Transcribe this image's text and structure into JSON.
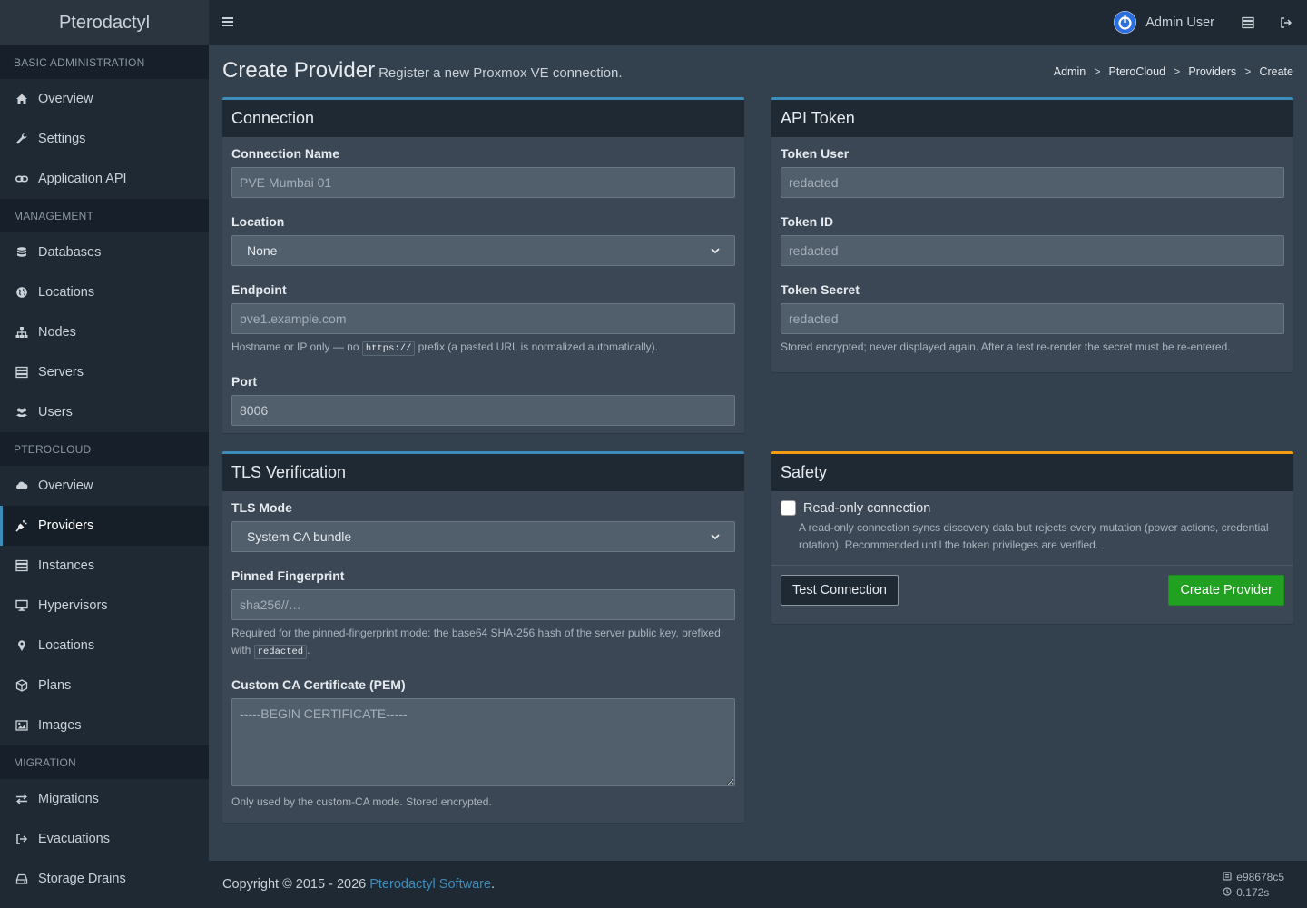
{
  "brand": "Pterodactyl",
  "sidebar": {
    "sections": [
      {
        "title": "BASIC ADMINISTRATION",
        "items": [
          {
            "label": "Overview",
            "icon": "home-icon"
          },
          {
            "label": "Settings",
            "icon": "wrench-icon"
          },
          {
            "label": "Application API",
            "icon": "link-icon"
          }
        ]
      },
      {
        "title": "MANAGEMENT",
        "items": [
          {
            "label": "Databases",
            "icon": "database-icon"
          },
          {
            "label": "Locations",
            "icon": "globe-icon"
          },
          {
            "label": "Nodes",
            "icon": "sitemap-icon"
          },
          {
            "label": "Servers",
            "icon": "server-icon"
          },
          {
            "label": "Users",
            "icon": "users-icon"
          }
        ]
      },
      {
        "title": "PTEROCLOUD",
        "items": [
          {
            "label": "Overview",
            "icon": "cloud-icon"
          },
          {
            "label": "Providers",
            "icon": "plug-icon"
          },
          {
            "label": "Instances",
            "icon": "server-icon"
          },
          {
            "label": "Hypervisors",
            "icon": "desktop-icon"
          },
          {
            "label": "Locations",
            "icon": "map-marker-icon"
          },
          {
            "label": "Plans",
            "icon": "cube-icon"
          },
          {
            "label": "Images",
            "icon": "image-icon"
          }
        ]
      },
      {
        "title": "MIGRATION",
        "items": [
          {
            "label": "Migrations",
            "icon": "exchange-icon"
          },
          {
            "label": "Evacuations",
            "icon": "sign-out-icon"
          },
          {
            "label": "Storage Drains",
            "icon": "hdd-icon"
          }
        ]
      }
    ],
    "active_item": "Providers"
  },
  "topbar": {
    "user_name": "Admin User"
  },
  "page": {
    "title": "Create Provider",
    "subtitle": "Register a new Proxmox VE connection.",
    "breadcrumb": [
      "Admin",
      "PteroCloud",
      "Providers",
      "Create"
    ],
    "breadcrumb_separator": ">"
  },
  "connection": {
    "title": "Connection",
    "name_label": "Connection Name",
    "name_placeholder": "PVE Mumbai 01",
    "location_label": "Location",
    "location_value": "None",
    "endpoint_label": "Endpoint",
    "endpoint_placeholder": "pve1.example.com",
    "endpoint_help_pre": "Hostname or IP only — no",
    "endpoint_help_code": "https://",
    "endpoint_help_post": "prefix (a pasted URL is normalized automatically).",
    "port_label": "Port",
    "port_value": "8006"
  },
  "api_token": {
    "title": "API Token",
    "user_label": "Token User",
    "user_placeholder": "redacted",
    "id_label": "Token ID",
    "id_placeholder": "redacted",
    "secret_label": "Token Secret",
    "secret_placeholder": "redacted",
    "secret_help": "Stored encrypted; never displayed again. After a test re-render the secret must be re-entered."
  },
  "tls": {
    "title": "TLS Verification",
    "mode_label": "TLS Mode",
    "mode_value": "System CA bundle",
    "fingerprint_label": "Pinned Fingerprint",
    "fingerprint_placeholder": "sha256//…",
    "fingerprint_help_pre": "Required for the pinned-fingerprint mode: the base64 SHA-256 hash of the server public key, prefixed with",
    "fingerprint_help_code": "redacted",
    "fingerprint_help_post": ".",
    "ca_label": "Custom CA Certificate (PEM)",
    "ca_placeholder": "-----BEGIN CERTIFICATE-----",
    "ca_help": "Only used by the custom-CA mode. Stored encrypted."
  },
  "safety": {
    "title": "Safety",
    "readonly_label": "Read-only connection",
    "readonly_checked": false,
    "readonly_help": "A read-only connection syncs discovery data but rejects every mutation (power actions, credential rotation). Recommended until the token privileges are verified.",
    "test_button": "Test Connection",
    "create_button": "Create Provider"
  },
  "footer": {
    "copyright_pre": "Copyright © 2015 - 2026",
    "copyright_link": "Pterodactyl Software",
    "copyright_post": ".",
    "version": "e98678c5",
    "time": "0.172s"
  },
  "colors": {
    "accent": "#3c8dbc",
    "warning": "#f39c12",
    "success": "#22a022"
  }
}
